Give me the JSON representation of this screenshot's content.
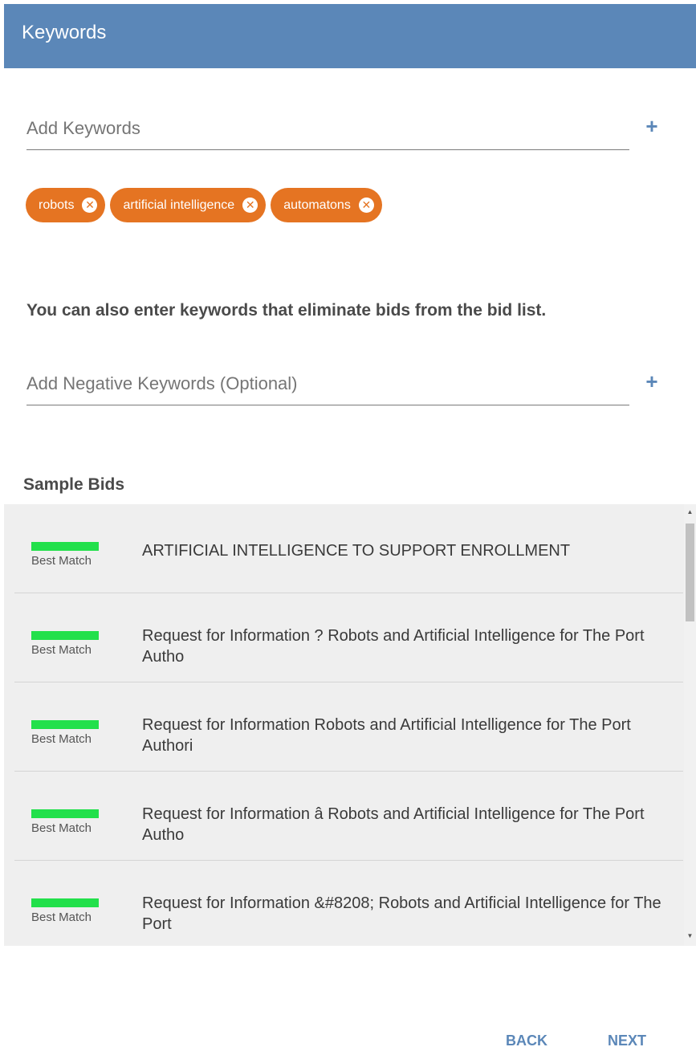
{
  "header": {
    "title": "Keywords"
  },
  "keywords": {
    "placeholder": "Add Keywords",
    "add_icon": "plus-icon",
    "chips": [
      {
        "label": "robots"
      },
      {
        "label": "artificial intelligence"
      },
      {
        "label": "automatons"
      }
    ]
  },
  "negative": {
    "note": "You can also enter keywords that eliminate bids from the bid list.",
    "placeholder": "Add Negative Keywords (Optional)"
  },
  "sample_bids": {
    "title": "Sample Bids",
    "items": [
      {
        "match": "Best Match",
        "title": "ARTIFICIAL INTELLIGENCE TO SUPPORT ENROLLMENT"
      },
      {
        "match": "Best Match",
        "title": "Request for Information ? Robots and Artificial Intelligence for The Port Autho"
      },
      {
        "match": "Best Match",
        "title": "Request for Information Robots and Artificial Intelligence for The Port Authori"
      },
      {
        "match": "Best Match",
        "title": "Request for Information â Robots and Artificial Intelligence for The Port Autho"
      },
      {
        "match": "Best Match",
        "title": "Request for Information &#8208; Robots and Artificial Intelligence for The Port"
      }
    ]
  },
  "footer": {
    "back": "BACK",
    "next": "NEXT"
  },
  "colors": {
    "header": "#5b87b8",
    "chip": "#e57422",
    "match_bar": "#22e04b",
    "accent": "#5b87b8"
  }
}
